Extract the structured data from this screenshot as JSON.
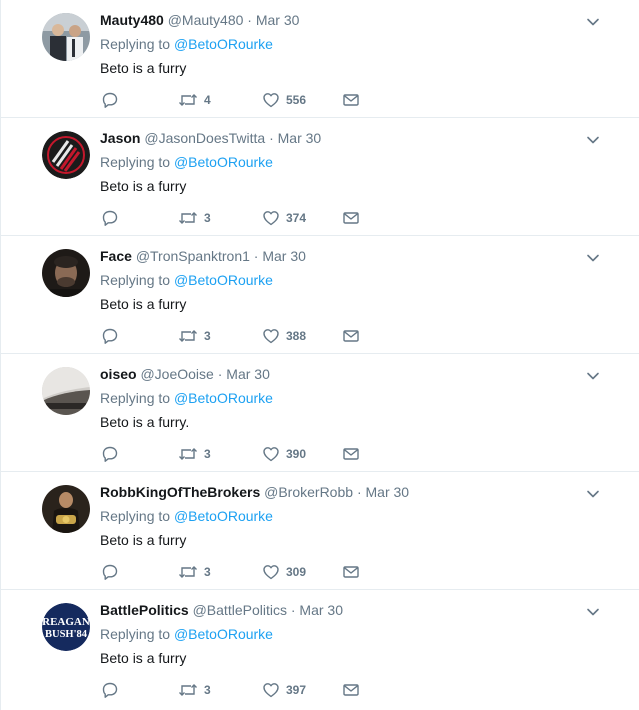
{
  "reply_label": "Replying to",
  "tweets": [
    {
      "name": "Mauty480",
      "handle": "@Mauty480",
      "time": "Mar 30",
      "mention": "@BetoORourke",
      "text": "Beto is a furry",
      "retweets": "4",
      "likes": "556",
      "avatar": "photo-two-people"
    },
    {
      "name": "Jason",
      "handle": "@JasonDoesTwitta",
      "time": "Mar 30",
      "mention": "@BetoORourke",
      "text": "Beto is a furry",
      "retweets": "3",
      "likes": "374",
      "avatar": "blazers-logo"
    },
    {
      "name": "Face",
      "handle": "@TronSpanktron1",
      "time": "Mar 30",
      "mention": "@BetoORourke",
      "text": "Beto is a furry",
      "retweets": "3",
      "likes": "388",
      "avatar": "dark-face-photo"
    },
    {
      "name": "oiseo",
      "handle": "@JoeOoise",
      "time": "Mar 30",
      "mention": "@BetoORourke",
      "text": "Beto is a furry.",
      "retweets": "3",
      "likes": "390",
      "avatar": "grey-photo"
    },
    {
      "name": "RobbKingOfTheBrokers",
      "handle": "@BrokerRobb",
      "time": "Mar 30",
      "mention": "@BetoORourke",
      "text": "Beto is a furry",
      "retweets": "3",
      "likes": "309",
      "avatar": "wrestler-belt-photo"
    },
    {
      "name": "BattlePolitics",
      "handle": "@BattlePolitics",
      "time": "Mar 30",
      "mention": "@BetoORourke",
      "text": "Beto is a furry",
      "retweets": "3",
      "likes": "397",
      "avatar": "reagan-bush-84-logo",
      "avatar_text": [
        "REAGAN",
        "BUSH'84"
      ]
    }
  ],
  "colors": {
    "accent": "#1da1f2",
    "secondary": "#657786",
    "border": "#e6ecf0"
  }
}
